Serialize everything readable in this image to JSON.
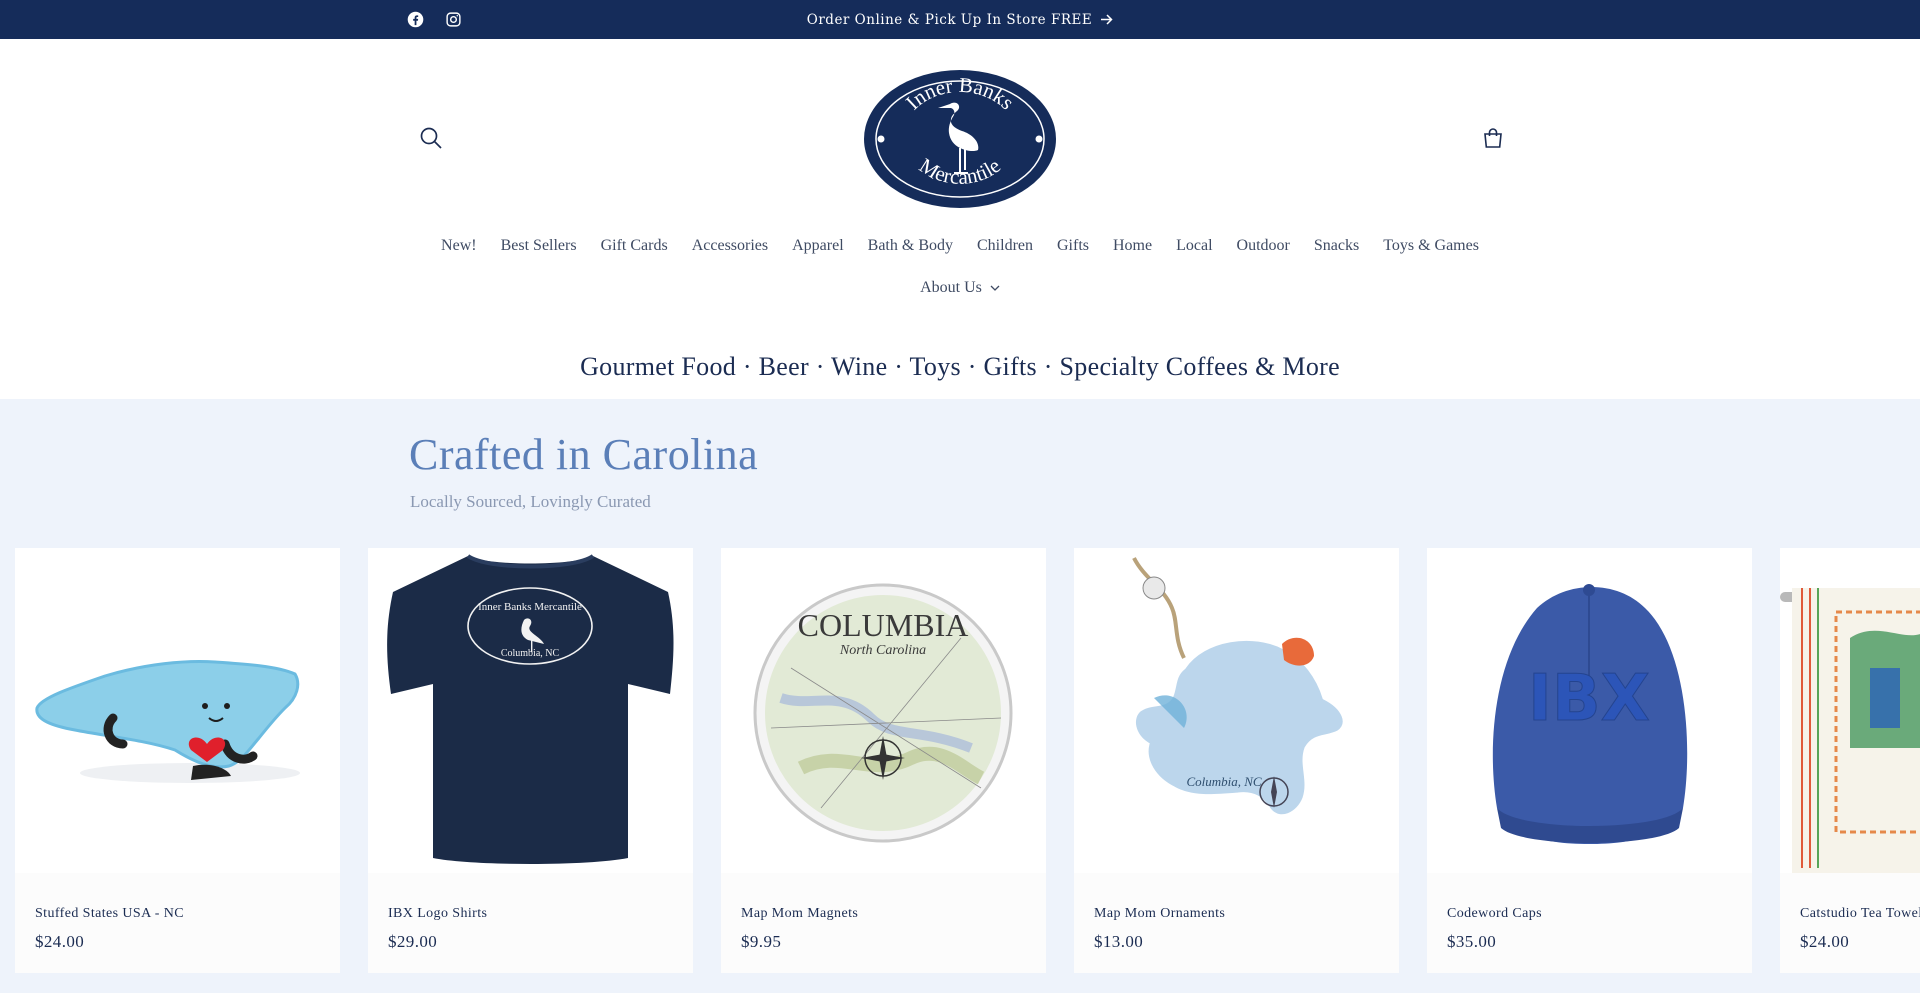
{
  "announcement": {
    "message": "Order Online & Pick Up In Store FREE",
    "social": [
      "facebook-icon",
      "instagram-icon"
    ]
  },
  "header": {
    "logo": {
      "line1": "Inner Banks",
      "line2": "Mercantile"
    },
    "search_icon": "search-icon",
    "cart_icon": "cart-icon"
  },
  "nav": {
    "row1": [
      "New!",
      "Best Sellers",
      "Gift Cards",
      "Accessories",
      "Apparel",
      "Bath & Body",
      "Children",
      "Gifts",
      "Home",
      "Local",
      "Outdoor",
      "Snacks",
      "Toys & Games"
    ],
    "row2": [
      "About Us"
    ]
  },
  "tagline": "Gourmet Food · Beer · Wine · Toys · Gifts · Specialty Coffees & More",
  "collection": {
    "title": "Crafted in Carolina",
    "subtitle": "Locally Sourced, Lovingly Curated",
    "products": [
      {
        "name": "Stuffed States USA - NC",
        "price": "$24.00"
      },
      {
        "name": "IBX Logo Shirts",
        "price": "$29.00",
        "print": {
          "line1": "Inner Banks Mercantile",
          "line2": "Columbia, NC"
        }
      },
      {
        "name": "Map Mom Magnets",
        "price": "$9.95",
        "print": {
          "line1": "COLUMBIA",
          "line2": "North Carolina"
        }
      },
      {
        "name": "Map Mom Ornaments",
        "price": "$13.00",
        "print": {
          "line1": "Columbia, NC"
        }
      },
      {
        "name": "Codeword Caps",
        "price": "$35.00",
        "print": {
          "line1": "IBX"
        }
      },
      {
        "name": "Catstudio Tea Towel",
        "price": "$24.00"
      }
    ]
  },
  "colors": {
    "navy": "#152c5a",
    "accent_blue": "#5b7fb8",
    "section_bg": "#eef3fb"
  }
}
